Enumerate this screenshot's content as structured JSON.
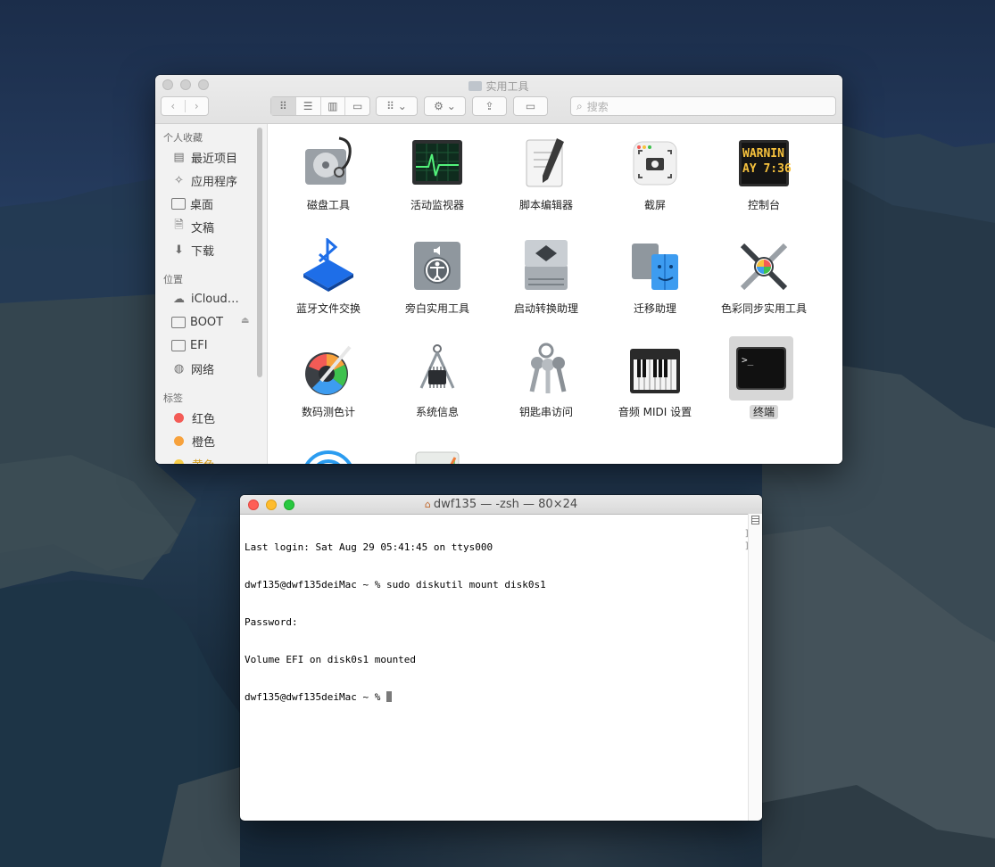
{
  "finder": {
    "title": "实用工具",
    "folder_icon": "folder-icon",
    "toolbar": {
      "back_glyph": "‹",
      "forward_glyph": "›",
      "view_glyphs": [
        "⠿",
        "☰",
        "▥",
        "▭"
      ],
      "arrange_glyph": "⠿ ⌄",
      "action_glyph": "⚙ ⌄",
      "share_glyph": "⇪",
      "tag_glyph": "▭",
      "search_placeholder": "搜索"
    },
    "sidebar": {
      "favorites_header": "个人收藏",
      "favorites": [
        {
          "label": "最近项目",
          "icon": "recents-icon"
        },
        {
          "label": "应用程序",
          "icon": "applications-icon"
        },
        {
          "label": "桌面",
          "icon": "desktop-icon"
        },
        {
          "label": "文稿",
          "icon": "documents-icon"
        },
        {
          "label": "下载",
          "icon": "downloads-icon"
        }
      ],
      "locations_header": "位置",
      "locations": [
        {
          "label": "iCloud…",
          "icon": "icloud-icon"
        },
        {
          "label": "BOOT",
          "icon": "disk-icon",
          "eject": "⏏"
        },
        {
          "label": "EFI",
          "icon": "disk-icon"
        },
        {
          "label": "网络",
          "icon": "network-icon"
        }
      ],
      "tags_header": "标签",
      "tags": [
        {
          "label": "红色",
          "color": "#f35b56"
        },
        {
          "label": "橙色",
          "color": "#f7a23d"
        },
        {
          "label": "黄色",
          "color": "#f8cd47"
        }
      ]
    },
    "apps": [
      {
        "label": "磁盘工具",
        "icon": "disk-utility-icon"
      },
      {
        "label": "活动监视器",
        "icon": "activity-monitor-icon"
      },
      {
        "label": "脚本编辑器",
        "icon": "script-editor-icon"
      },
      {
        "label": "截屏",
        "icon": "screenshot-icon"
      },
      {
        "label": "控制台",
        "icon": "console-icon",
        "screen_text": "WARNIN\nAY 7:36"
      },
      {
        "label": "蓝牙文件交换",
        "icon": "bluetooth-icon"
      },
      {
        "label": "旁白实用工具",
        "icon": "voiceover-icon"
      },
      {
        "label": "启动转换助理",
        "icon": "boot-camp-icon"
      },
      {
        "label": "迁移助理",
        "icon": "migration-assistant-icon"
      },
      {
        "label": "色彩同步实用工具",
        "icon": "colorsync-icon"
      },
      {
        "label": "数码测色计",
        "icon": "color-meter-icon"
      },
      {
        "label": "系统信息",
        "icon": "system-information-icon"
      },
      {
        "label": "钥匙串访问",
        "icon": "keychain-icon"
      },
      {
        "label": "音频 MIDI 设置",
        "icon": "audio-midi-icon"
      },
      {
        "label": "终端",
        "icon": "terminal-icon",
        "selected": true,
        "prompt": ">_"
      }
    ]
  },
  "terminal": {
    "title": "dwf135 — -zsh — 80×24",
    "home_glyph": "⌂",
    "lines": [
      "Last login: Sat Aug 29 05:41:45 on ttys000",
      "dwf135@dwf135deiMac ~ % sudo diskutil mount disk0s1",
      "Password:",
      "Volume EFI on disk0s1 mounted",
      "dwf135@dwf135deiMac ~ % "
    ],
    "mark_glyph": "]"
  }
}
